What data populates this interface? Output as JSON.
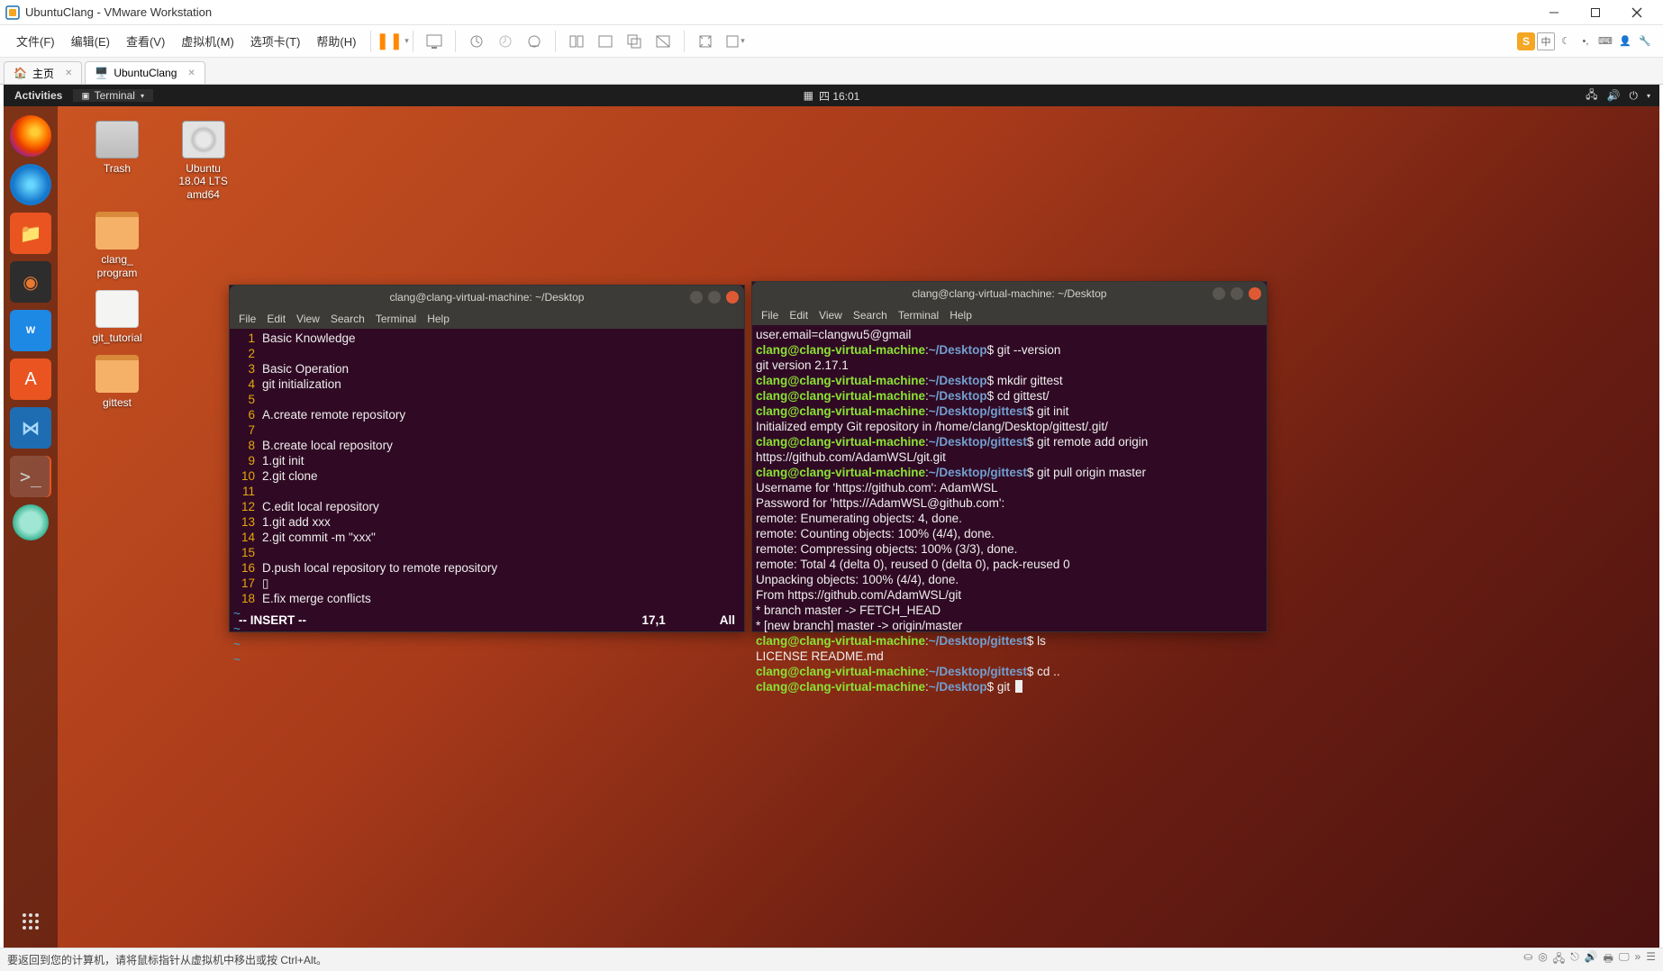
{
  "window": {
    "title": "UbuntuClang - VMware Workstation"
  },
  "menu": {
    "file": "文件(F)",
    "edit": "编辑(E)",
    "view": "查看(V)",
    "vm": "虚拟机(M)",
    "tabs": "选项卡(T)",
    "help": "帮助(H)"
  },
  "ime": {
    "zhong": "中"
  },
  "tabs": {
    "home": "主页",
    "vm_name": "UbuntuClang"
  },
  "ubuntu_top": {
    "activities": "Activities",
    "app": "Terminal",
    "clock": "四 16:01"
  },
  "desktop_icons": {
    "trash": "Trash",
    "disc": "Ubuntu\n18.04 LTS\namd64",
    "clang_program": "clang_\nprogram",
    "git_tutorial": "git_tutorial",
    "gittest": "gittest"
  },
  "term1": {
    "title": "clang@clang-virtual-machine: ~/Desktop",
    "menu": {
      "file": "File",
      "edit": "Edit",
      "view": "View",
      "search": "Search",
      "terminal": "Terminal",
      "help": "Help"
    },
    "lines": [
      {
        "n": "1",
        "t": "Basic Knowledge"
      },
      {
        "n": "2",
        "t": ""
      },
      {
        "n": "3",
        "t": "Basic Operation"
      },
      {
        "n": "4",
        "t": "git initialization"
      },
      {
        "n": "5",
        "t": ""
      },
      {
        "n": "6",
        "t": "A.create remote repository"
      },
      {
        "n": "7",
        "t": ""
      },
      {
        "n": "8",
        "t": "B.create local repository"
      },
      {
        "n": "9",
        "t": "1.git init"
      },
      {
        "n": "10",
        "t": "2.git clone"
      },
      {
        "n": "11",
        "t": ""
      },
      {
        "n": "12",
        "t": "C.edit local repository"
      },
      {
        "n": "13",
        "t": "1.git add xxx"
      },
      {
        "n": "14",
        "t": "2.git commit -m \"xxx\""
      },
      {
        "n": "15",
        "t": ""
      },
      {
        "n": "16",
        "t": "D.push local repository to remote repository"
      },
      {
        "n": "17",
        "t": "▯"
      },
      {
        "n": "18",
        "t": "E.fix merge conflicts"
      }
    ],
    "status": {
      "mode": "-- INSERT --",
      "pos": "17,1",
      "all": "All"
    }
  },
  "term2": {
    "title": "clang@clang-virtual-machine: ~/Desktop",
    "menu": {
      "file": "File",
      "edit": "Edit",
      "view": "View",
      "search": "Search",
      "terminal": "Terminal",
      "help": "Help"
    },
    "prompt": {
      "user_desktop": "clang@clang-virtual-machine",
      "path_desktop": "~/Desktop",
      "path_gittest": "~/Desktop/gittest"
    },
    "lines": {
      "l1": "user.email=clangwu5@gmail",
      "cmd_version": "git --version",
      "out_version": "git version 2.17.1",
      "cmd_mkdir": "mkdir gittest",
      "cmd_cd": "cd gittest/",
      "cmd_init": "git init",
      "out_init": "Initialized empty Git repository in /home/clang/Desktop/gittest/.git/",
      "cmd_remote": "git remote add origin https://github.com/AdamWSL/git.git",
      "cmd_pull": "git pull origin master",
      "out_user": "Username for 'https://github.com': AdamWSL",
      "out_pass": "Password for 'https://AdamWSL@github.com':",
      "out_enum": "remote: Enumerating objects: 4, done.",
      "out_count": "remote: Counting objects: 100% (4/4), done.",
      "out_comp": "remote: Compressing objects: 100% (3/3), done.",
      "out_total": "remote: Total 4 (delta 0), reused 0 (delta 0), pack-reused 0",
      "out_unpack": "Unpacking objects: 100% (4/4), done.",
      "out_from": "From https://github.com/AdamWSL/git",
      "out_branch1": " * branch            master     -> FETCH_HEAD",
      "out_branch2": " * [new branch]      master     -> origin/master",
      "cmd_ls": "ls",
      "out_ls": "LICENSE  README.md",
      "cmd_cdup": "cd ..",
      "cmd_git": "git "
    }
  },
  "footer": {
    "hint": "要返回到您的计算机，请将鼠标指针从虚拟机中移出或按 Ctrl+Alt。"
  }
}
